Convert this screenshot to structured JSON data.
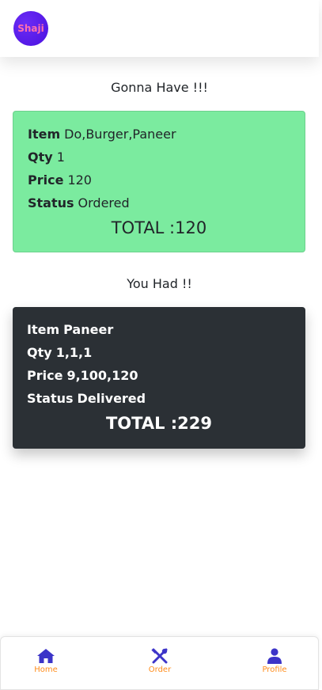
{
  "header": {
    "logo_text": "Shaji"
  },
  "pending": {
    "title": "Gonna Have !!!",
    "item_label": "Item",
    "item_value": "Do,Burger,Paneer",
    "qty_label": "Qty",
    "qty_value": "1",
    "price_label": "Price",
    "price_value": "120",
    "status_label": "Status",
    "status_value": "Ordered",
    "total": "TOTAL :120"
  },
  "past": {
    "title": "You Had !!",
    "item_label": "Item",
    "item_value": "Paneer",
    "qty_label": "Qty",
    "qty_value": "1,1,1",
    "price_label": "Price",
    "price_value": "9,100,120",
    "status_label": "Status",
    "status_value": "Delivered",
    "total": "TOTAL :229"
  },
  "nav": {
    "home": "Home",
    "order": "Order",
    "profile": "Profile"
  },
  "colors": {
    "pending_card": "#7beb9f",
    "past_card": "#2b3035",
    "nav_icon": "#3c34c8",
    "nav_label": "#ff8c1a"
  },
  "icons": {
    "home": "home-icon",
    "order": "utensils-icon",
    "profile": "user-icon"
  }
}
